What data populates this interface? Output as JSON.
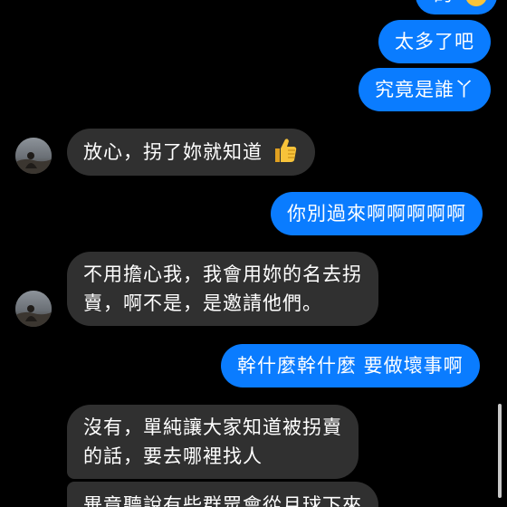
{
  "messages": [
    {
      "id": "m0",
      "side": "out",
      "text": "的"
    },
    {
      "id": "m1",
      "side": "out",
      "text": "太多了吧"
    },
    {
      "id": "m2",
      "side": "out",
      "text": "究竟是誰丫"
    },
    {
      "id": "m3",
      "side": "in",
      "text": "放心，拐了妳就知道"
    },
    {
      "id": "m4",
      "side": "out",
      "text": "你別過來啊啊啊啊啊"
    },
    {
      "id": "m5",
      "side": "in",
      "lines": [
        "不用擔心我，我會用妳的名去拐",
        "賣，啊不是，是邀請他們。"
      ]
    },
    {
      "id": "m6",
      "side": "out",
      "text": "幹什麼幹什麼 要做壞事啊"
    },
    {
      "id": "m7",
      "side": "in",
      "lines": [
        "沒有，單純讓大家知道被拐賣",
        "的話，要去哪裡找人"
      ]
    },
    {
      "id": "m8",
      "side": "in",
      "text": "畢竟聽說有些群眾會從月球下來"
    }
  ],
  "icons": {
    "thumbs_up": "thumbs-up-emoji",
    "partial_emoji": "smiley-emoji",
    "avatar": "contact-avatar"
  },
  "colors": {
    "background": "#000000",
    "outgoing_bubble": "#0a7cff",
    "incoming_bubble": "#303030",
    "text": "#ffffff"
  }
}
